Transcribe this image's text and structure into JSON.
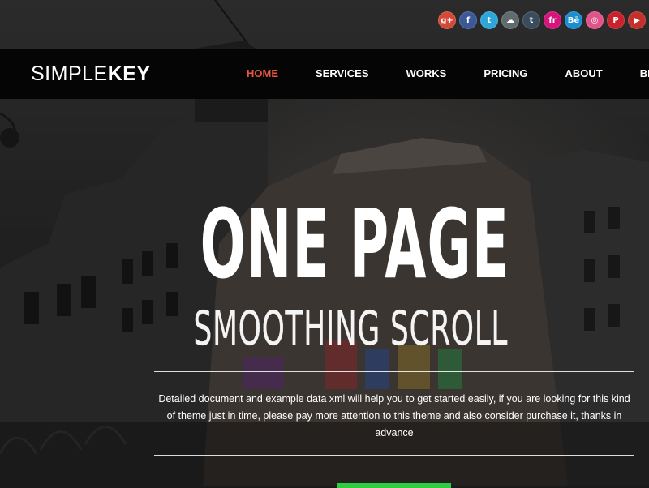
{
  "social": [
    {
      "name": "google-plus-icon",
      "glyph": "g+",
      "color": "#d34836"
    },
    {
      "name": "facebook-icon",
      "glyph": "f",
      "color": "#3b5998"
    },
    {
      "name": "twitter-icon",
      "glyph": "t",
      "color": "#2fa6d8"
    },
    {
      "name": "cloud-icon",
      "glyph": "☁",
      "color": "#5f6b6d"
    },
    {
      "name": "tumblr-icon",
      "glyph": "t",
      "color": "#3a4b5e"
    },
    {
      "name": "flickr-icon",
      "glyph": "fr",
      "color": "#d6147c"
    },
    {
      "name": "behance-icon",
      "glyph": "Bē",
      "color": "#1a8fd0"
    },
    {
      "name": "dribbble-icon",
      "glyph": "◎",
      "color": "#e25389"
    },
    {
      "name": "pinterest-icon",
      "glyph": "P",
      "color": "#c8232c"
    },
    {
      "name": "youtube-icon",
      "glyph": "▶",
      "color": "#c4302b"
    }
  ],
  "logo": {
    "thin": "SIMPLE",
    "bold": "KEY"
  },
  "nav": {
    "items": [
      "HOME",
      "SERVICES",
      "WORKS",
      "PRICING",
      "ABOUT",
      "BLOG"
    ],
    "active": "HOME",
    "active_color": "#e8553e"
  },
  "hero": {
    "title": "ONE PAGE",
    "subtitle": "SMOOTHING SCROLL",
    "description": "Detailed document and example data xml will help you to get started easily, if you are looking for this kind of theme just in time, please pay more attention to this theme and also consider purchase it, thanks in advance"
  }
}
